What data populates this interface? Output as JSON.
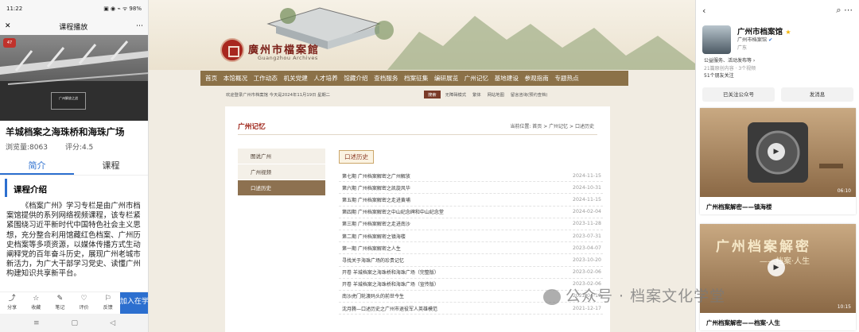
{
  "left": {
    "status": {
      "time": "11:22",
      "icons": "▣ ◉ ⌁ ᯤ 98%"
    },
    "nav": {
      "close": "✕",
      "title": "课程播放",
      "more": "⋯"
    },
    "video": {
      "logo": "47",
      "caption": "广州解放之战"
    },
    "title": "羊城档案之海珠桥和海珠广场",
    "views": "浏览量:8063",
    "rating": "评分:4.5",
    "tabs": [
      "简介",
      "课程"
    ],
    "section": "课程介绍",
    "intro": "《档案广州》学习专栏是由广州市档案馆提供的系列网络视频课程，该专栏紧紧围绕习近平新时代中国特色社会主义思想，充分整合利用馆藏红色档案、广州历史档案等多项资源，以媒体传播方式生动阐释党的百年奋斗历史，展现广州老城市新活力，为广大干部学习党史、读懂广州构建知识共享新平台。",
    "bottom": [
      {
        "icon": "⤴",
        "label": "分享"
      },
      {
        "icon": "☆",
        "label": "收藏"
      },
      {
        "icon": "✎",
        "label": "笔记"
      },
      {
        "icon": "♡",
        "label": "评价"
      },
      {
        "icon": "⚐",
        "label": "反馈"
      }
    ],
    "add": "加入在学",
    "sys": [
      "≡",
      "▢",
      "◁"
    ]
  },
  "center": {
    "site_name": "廣州市檔案館",
    "site_sub": "Guangzhou Archives",
    "nav": [
      "首页",
      "本馆概况",
      "工作动态",
      "机关党建",
      "人才培养",
      "馆藏介绍",
      "查档服务",
      "档案征集",
      "编研展览",
      "广州记忆",
      "基地建设",
      "参观指南",
      "专题热点"
    ],
    "info": "欢迎登录广州市档案馆  今天是2024年11月19日 星期二",
    "search": "搜索",
    "links": [
      "无障碍模式",
      "繁体",
      "网站地图",
      "留言咨询(预约查档)"
    ],
    "page_title": "广州记忆",
    "breadcrumb": "当前位置: 首页 > 广州记忆 > 口述历史",
    "side": [
      "图说广州",
      "广州视频",
      "口述历史"
    ],
    "list_tag": "口述历史",
    "rows": [
      {
        "t": "第七期 广州档案解密之广州解放",
        "d": "2024-11-15"
      },
      {
        "t": "第六期 广州档案解密之凯旋风华",
        "d": "2024-10-31"
      },
      {
        "t": "第五期 广州档案解密之走进黄埔",
        "d": "2024-11-15"
      },
      {
        "t": "第四期 广州档案解密之中山纪念碑和中山纪念堂",
        "d": "2024-02-04"
      },
      {
        "t": "第三期 广州档案解密之走进南沙",
        "d": "2023-11-28"
      },
      {
        "t": "第二期 广州档案解密之镇海楼",
        "d": "2023-07-31"
      },
      {
        "t": "第一期 广州档案解密之人生",
        "d": "2023-04-07"
      },
      {
        "t": "寻找关于海珠广场的珍贵记忆",
        "d": "2023-10-20"
      },
      {
        "t": "开卷 羊城档案之海珠桥和海珠广场（完整版）",
        "d": "2023-02-06"
      },
      {
        "t": "开卷 羊城档案之海珠桥和海珠广场（宣传版）",
        "d": "2023-02-06"
      },
      {
        "t": "南沙虎门轮渡码头的前世今生",
        "d": "2022-04-19"
      },
      {
        "t": "沈月腾—口述历史之广州市退役军人英雄模范",
        "d": "2021-12-17"
      }
    ]
  },
  "right": {
    "back": "‹",
    "icons": "⌕ ⋯",
    "name": "广州市档案馆",
    "star": "★",
    "sub": "广州市档案馆",
    "verified": "✔",
    "loc": "广东",
    "desc1": "公益服务、活动发布等 ›",
    "desc2": "21篇原创内容 · 3个视频",
    "desc3": "51个朋友关注",
    "btn1": "已关注公众号",
    "btn2": "发消息",
    "videos": [
      {
        "title": "广州档案解密——镇海楼",
        "dur": "06:10"
      },
      {
        "title": "广州档案解密——档案·人生",
        "dur": "10:15",
        "big": "广州档案解密",
        "big2": "——档案·人生"
      }
    ],
    "play": "▶"
  },
  "watermark": "公众号 · 档案文化学堂"
}
